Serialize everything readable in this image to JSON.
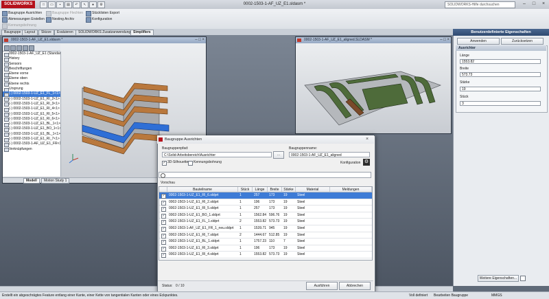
{
  "app": {
    "brand": "SOLIDWORKS",
    "window_title": "0002-1503-1-AF_UZ_E1.sldasm *",
    "help_search_placeholder": "SOLIDWORKS-Hilfe durchsuchen"
  },
  "ribbon": {
    "col1": [
      "Baugruppe Ausrichten",
      "Abmessungen Erstellen",
      "Kennungsbohrung"
    ],
    "col2": [
      "Baugruppe Flechten",
      "Nesting Archiv"
    ],
    "col3": [
      "Stücklisten Export",
      "Konfiguration"
    ]
  },
  "tabs": [
    "Baugruppe",
    "Layout",
    "Skizze",
    "Evaluieren",
    "SOLIDWORKS Zusatzanwendungen",
    "Simplifiers"
  ],
  "doc1": {
    "title": "0002-1503-1-AF_UZ_E1.sldasm *"
  },
  "doc2": {
    "title": "0002-1503-1-AF_UZ_E1_aligned.SLDASM *"
  },
  "tree": {
    "items": [
      "0002-1503-1-AF_UZ_E1 (Standard)",
      "History",
      "Sensors",
      "Beschriftungen",
      "Ebene vorne",
      "Ebene oben",
      "Ebene rechts",
      "Ursprung",
      "(-) 0002-1503-1-UZ_E1_FL_1<1>",
      "(-) 0002-1503-1-UZ_E1_RI_2<1>",
      "(-) 0002-1503-1-UZ_E1_RI_3<1>",
      "(-) 0002-1503-1-UZ_E1_RI_4<1>",
      "(-) 0002-1503-1-UZ_E1_RI_5<1>",
      "(-) 0002-1503-1-UZ_E1_RI_6<1>",
      "(-) 0002-1503-1-UZ_E1_BL_1<1>",
      "(-) 0002-1503-1-UZ_E1_BO_1<1>",
      "(-) 0002-1503-1-UZ_E1_BL_1<1>",
      "(-) 0002-1503-1-UZ_E1_RI_7<1>",
      "(-) 0002-1503-1-AF_UZ_E1_FR<1>",
      "Verknüpfungen"
    ],
    "bottom_tabs": [
      "Modell",
      "Motion Study 1"
    ]
  },
  "props": {
    "title": "Benutzerdefinierte Eigenschaften",
    "apply": "Anwenden",
    "reset": "Zurücksetzen",
    "group": "Ausrichter",
    "fields": [
      {
        "label": "Länge",
        "value": "1553.82"
      },
      {
        "label": "Breite",
        "value": "573.73"
      },
      {
        "label": "Stärke",
        "value": "19"
      },
      {
        "label": "Stück",
        "value": "3"
      }
    ],
    "more": "Weitere Eigenschaften..."
  },
  "dialog": {
    "title": "Baugruppe Ausrichten",
    "source_label": "Baugruppenpfad:",
    "source_value": "C:\\Solid-Arbeitsbereich\\Ausrichter",
    "target_label": "Baugruppenname:",
    "target_value": "0002-1503-1-AF_UZ_E1_aligned",
    "browse": "...",
    "check_3d": "3D-Silhouette",
    "check_bore": "Kennungsbohrung",
    "config_label": "Konfiguration",
    "preview_label": "Vorschau",
    "columns": [
      "",
      "Bauteilname",
      "Stück",
      "Länge",
      "Breite",
      "Stärke",
      "Material",
      "Meldungen"
    ],
    "rows": [
      {
        "name": "0002-1503-1-UZ_E1_RI_6.sldprt",
        "qty": "1",
        "len": "257",
        "wid": "173",
        "thk": "19",
        "mat": "Steel",
        "selected": true
      },
      {
        "name": "0002-1503-1-UZ_E1_RI_2.sldprt",
        "qty": "1",
        "len": "196",
        "wid": "173",
        "thk": "19",
        "mat": "Steel",
        "selected": false
      },
      {
        "name": "0002-1503-1-UZ_E1_RI_5.sldprt",
        "qty": "1",
        "len": "257",
        "wid": "173",
        "thk": "19",
        "mat": "Steel",
        "selected": false
      },
      {
        "name": "0002-1503-1-UZ_E1_BO_1.sldprt",
        "qty": "1",
        "len": "1562.84",
        "wid": "596.76",
        "thk": "19",
        "mat": "Steel",
        "selected": false
      },
      {
        "name": "0002-1503-1-UZ_E1_FL_1.sldprt",
        "qty": "2",
        "len": "1553.82",
        "wid": "573.73",
        "thk": "19",
        "mat": "Steel",
        "selected": false
      },
      {
        "name": "0002-1503-1-AF_UZ_E1_FR_1_neu.sldprt",
        "qty": "1",
        "len": "1539.71",
        "wid": "945",
        "thk": "19",
        "mat": "Steel",
        "selected": false
      },
      {
        "name": "0002-1503-1-UZ_E1_RI_7.sldprt",
        "qty": "2",
        "len": "1444.67",
        "wid": "512.85",
        "thk": "19",
        "mat": "Steel",
        "selected": false
      },
      {
        "name": "0002-1503-1-UZ_E1_BL_1.sldprt",
        "qty": "1",
        "len": "1757.23",
        "wid": "110",
        "thk": "7",
        "mat": "Steel",
        "selected": false
      },
      {
        "name": "0002-1503-1-UZ_E1_RI_3.sldprt",
        "qty": "1",
        "len": "196",
        "wid": "173",
        "thk": "19",
        "mat": "Steel",
        "selected": false
      },
      {
        "name": "0002-1503-1-UZ_E1_RI_4.sldprt",
        "qty": "1",
        "len": "1553.82",
        "wid": "573.73",
        "thk": "19",
        "mat": "Steel",
        "selected": false
      }
    ],
    "status_label": "Status:",
    "status_value": "0 / 10",
    "run": "Ausführen",
    "cancel": "Abbrechen"
  },
  "statusbar": {
    "message": "Erstellt ein abgeschrägtes Feature entlang einer Kante, einer Kette von tangentialen Kanten oder eines Eckpunktes.",
    "defined": "Voll definiert",
    "editing": "Bearbeiten Baugruppe",
    "units": "MMGS"
  },
  "colors": {
    "accent": "#3d7bd6",
    "brand": "#b5121b",
    "part_wood": "#b9783d",
    "part_steel": "#a7a9ad",
    "part_blue": "#2f6fd6",
    "part_green": "#4e6b3a"
  }
}
